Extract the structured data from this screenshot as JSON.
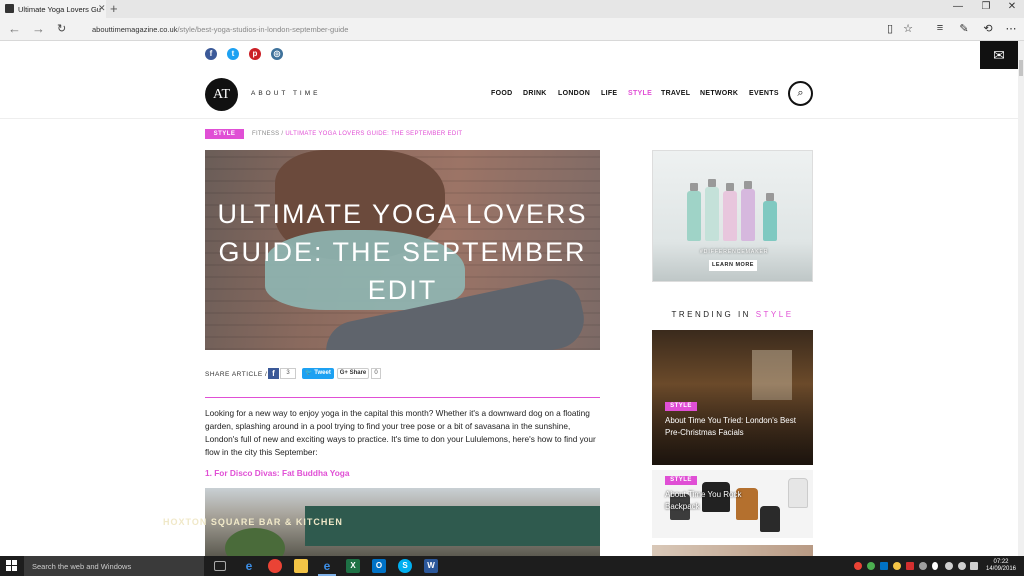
{
  "browser": {
    "tab_title": "Ultimate Yoga Lovers Gu",
    "url_domain": "abouttimemagazine.co.uk",
    "url_path": "/style/best-yoga-studios-in-london-september-guide"
  },
  "site": {
    "logo": "AT",
    "name": "ABOUT TIME",
    "nav": [
      "FOOD",
      "DRINK",
      "LONDON",
      "LIFE",
      "STYLE",
      "TRAVEL",
      "NETWORK",
      "EVENTS"
    ],
    "active_nav": "STYLE",
    "accent_color": "#e04fd5"
  },
  "breadcrumb": {
    "category": "STYLE",
    "sub": "FITNESS /",
    "current": "ULTIMATE YOGA LOVERS GUIDE: THE SEPTEMBER EDIT"
  },
  "article": {
    "title": "ULTIMATE YOGA LOVERS GUIDE: THE SEPTEMBER EDIT",
    "share_label": "SHARE ARTICLE /",
    "fb_count": "3",
    "tweet_label": "Tweet",
    "gplus_label": "Share",
    "gplus_count": "0",
    "intro": "Looking for a new way to enjoy yoga in the capital this month? Whether it's a downward dog on a floating garden, splashing around in a pool trying to find your tree pose or a bit of savasana in the sunshine, London's full of new and exciting ways to practice. It's time to don your Lululemons, here's how to find your flow in the city this September:",
    "section1": "1. For Disco Divas: Fat Buddha Yoga",
    "photo_sign": "HOXTON SQUARE BAR & KITCHEN"
  },
  "sidebar": {
    "ad_tag": "#DIFFERENCEMAKER",
    "ad_button": "LEARN MORE",
    "trending_prefix": "TRENDING IN",
    "trending_category": "STYLE",
    "cards": [
      {
        "badge": "STYLE",
        "title": "About Time You Tried: London's Best Pre-Christmas Facials"
      },
      {
        "badge": "STYLE",
        "title": "About Time You Rock Backpack"
      }
    ]
  },
  "taskbar": {
    "search_placeholder": "Search the web and Windows",
    "time": "07:22",
    "date": "14/09/2016"
  }
}
